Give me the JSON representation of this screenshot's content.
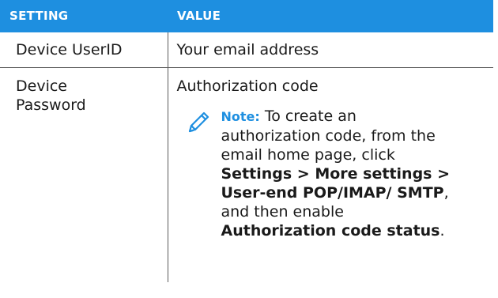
{
  "table": {
    "header": {
      "setting": "SETTING",
      "value": "VALUE"
    },
    "rows": [
      {
        "setting": "Device UserID",
        "value": "Your email address"
      },
      {
        "setting_line1": "Device",
        "setting_line2": "Password",
        "value": "Authorization code",
        "note": {
          "label": "Note:",
          "intro": " To create an authorization code, from the email home page, click ",
          "path": "Settings > More settings > User-end POP/IMAP/ SMTP",
          "middle": ", and then enable ",
          "option": "Authorization code status",
          "end": "."
        }
      }
    ]
  },
  "colors": {
    "header_bg": "#1e8fe0",
    "header_text": "#ffffff",
    "note_label": "#1e8fe0",
    "border": "#5b5b5b"
  },
  "icons": {
    "note": "pencil-icon"
  }
}
